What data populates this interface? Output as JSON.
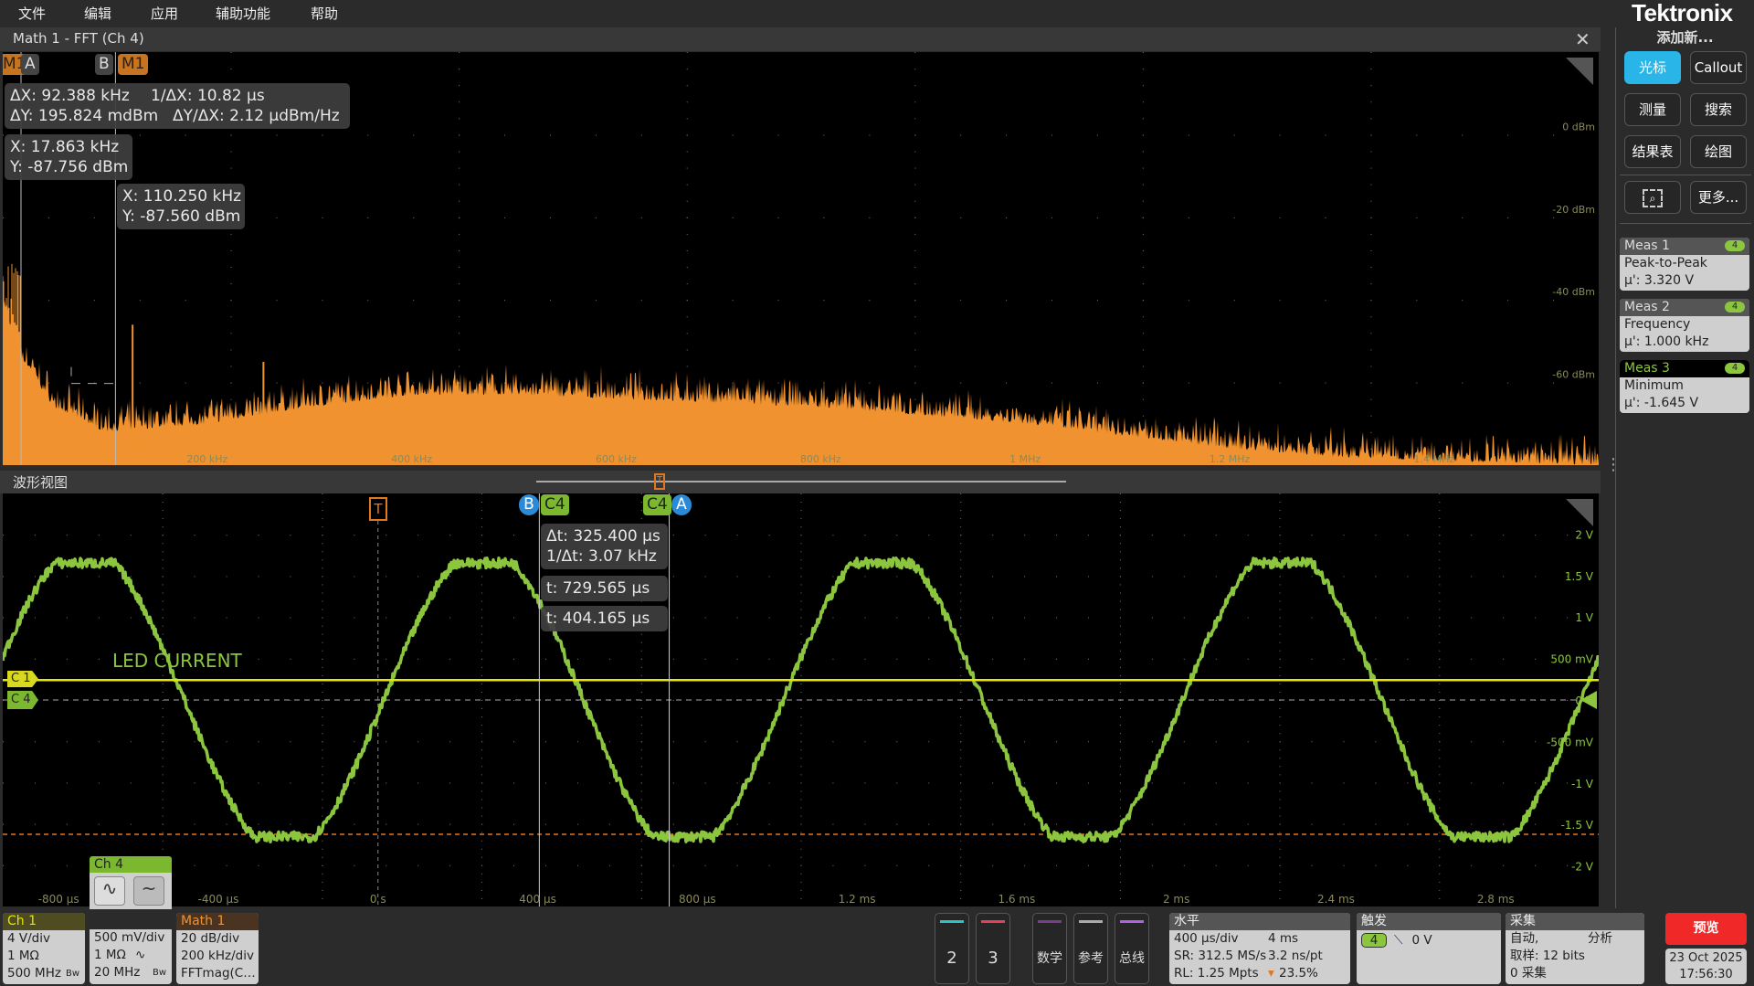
{
  "menu": [
    "文件",
    "编辑",
    "应用",
    "辅助功能",
    "帮助"
  ],
  "brand": "Tektronix",
  "fft_pane": {
    "title": "Math 1 - FFT (Ch 4)",
    "tags": {
      "m1_left": "M1",
      "a": "A",
      "b": "B",
      "m1": "M1"
    },
    "delta_readout": {
      "dx": "ΔX: 92.388 kHz",
      "inv_dx": "1/ΔX: 10.82 µs",
      "dy": "ΔY: 195.824 mdBm",
      "dydx": "ΔY/ΔX: 2.12 µdBm/Hz"
    },
    "cursor_a": {
      "x": "X: 17.863 kHz",
      "y": "Y: -87.756 dBm"
    },
    "cursor_b": {
      "x": "X: 110.250 kHz",
      "y": "Y: -87.560 dBm"
    }
  },
  "wave_pane": {
    "title": "波形视图",
    "tags": {
      "b": "B",
      "c4_b": "C4",
      "c4_a": "C4",
      "a": "A",
      "trigger": "T",
      "c1": "C 1",
      "c4": "C 4"
    },
    "label": "LED CURRENT",
    "delta_readout": {
      "dt": "Δt: 325.400 µs",
      "inv_dt": "1/Δt: 3.07 kHz"
    },
    "cursor_a_t": "t: 729.565 µs",
    "cursor_b_t": "t: 404.165 µs"
  },
  "chart_data": [
    {
      "type": "area",
      "xlabel_ticks": [
        "200 kHz",
        "400 kHz",
        "600 kHz",
        "800 kHz",
        "1 MHz",
        "1.2 MHz",
        "1.4 MHz"
      ],
      "ylabel_ticks": [
        "0 dBm",
        "-20 dBm",
        "-40 dBm",
        "-60 dBm"
      ],
      "xlim_hz": [
        0,
        1561000
      ],
      "ylim_dbm": [
        -82,
        18
      ],
      "color": "#f0922f",
      "envelope": {
        "x_hz": [
          0,
          20000,
          50000,
          100000,
          200000,
          300000,
          400000,
          500000,
          600000,
          700000,
          800000,
          900000,
          1000000,
          1100000,
          1200000,
          1300000,
          1400000,
          1561000
        ],
        "y_dbm": [
          -42,
          -55,
          -66,
          -72,
          -70,
          -66,
          -63,
          -63,
          -64,
          -65,
          -66,
          -68,
          -70,
          -73,
          -76,
          -78,
          -79,
          -80
        ]
      },
      "spurs": {
        "x_hz": [
          127000,
          255000,
          383000
        ],
        "y_dbm": [
          -48,
          -57,
          -66
        ]
      },
      "cursors_hz": {
        "A": 17863,
        "B": 110250
      }
    },
    {
      "type": "line",
      "xlabel_ticks": [
        "-800 µs",
        "-400 µs",
        "0 s",
        "400 µs",
        "800 µs",
        "1.2 ms",
        "1.6 ms",
        "2 ms",
        "2.4 ms",
        "2.8 ms"
      ],
      "ylabel_ticks": [
        "2 V",
        "1.5 V",
        "1 V",
        "500 mV",
        "0 V",
        "-500 mV",
        "-1 V",
        "-1.5 V",
        "-2 V"
      ],
      "xlim_us": [
        -940,
        3058
      ],
      "ylim_v": [
        -2.49,
        2.49
      ],
      "series": [
        {
          "name": "C4",
          "color": "#8cc63f",
          "waveform": "clipped sine",
          "frequency_hz": 1000,
          "amplitude_v": 1.85,
          "clip_v": 1.65
        },
        {
          "name": "C1",
          "color": "#e6e600",
          "level_v": 0.24
        }
      ],
      "threshold_v": -1.62,
      "cursors_us": {
        "A": 729.565,
        "B": 404.165
      },
      "trigger_us": 0
    }
  ],
  "side_panel": {
    "add_new": "添加新...",
    "buttons": [
      "光标",
      "Callout",
      "测量",
      "搜索",
      "结果表",
      "绘图",
      "更多..."
    ],
    "active_color": "#29b5e8",
    "meas": [
      {
        "title": "Meas 1",
        "badge": "4",
        "name": "Peak-to-Peak",
        "value": "µ': 3.320 V"
      },
      {
        "title": "Meas 2",
        "badge": "4",
        "name": "Frequency",
        "value": "µ': 1.000 kHz"
      },
      {
        "title": "Meas 3",
        "badge": "4",
        "name": "Minimum",
        "value": "µ': -1.645 V"
      }
    ]
  },
  "bottom": {
    "ch1": {
      "title": "Ch 1",
      "lines": [
        "4 V/div",
        "1 MΩ",
        "500 MHz"
      ],
      "bw": "Bw"
    },
    "ch4": {
      "title": "Ch 4",
      "lines": [
        "500 mV/div",
        "1 MΩ",
        "20 MHz"
      ],
      "bw": "Bw",
      "coupling": "∿"
    },
    "math1": {
      "title": "Math 1",
      "lines": [
        "20 dB/div",
        "200 kHz/div",
        "FFTmag(C…"
      ]
    },
    "buttons": [
      {
        "label": "2",
        "color": "#2bc4c4"
      },
      {
        "label": "3",
        "color": "#e8405a"
      },
      {
        "label": "数学",
        "color": "#7a3c8c"
      },
      {
        "label": "参考",
        "color": "#aaaaaa"
      },
      {
        "label": "总线",
        "color": "#b060e0"
      }
    ],
    "horizontal": {
      "title": "水平",
      "scale": "400 µs/div",
      "duration": "4 ms",
      "sr": "SR: 312.5 MS/s",
      "pt": "3.2 ns/pt",
      "rl": "RL: 1.25 Mpts",
      "pos": "23.5%"
    },
    "trigger": {
      "title": "触发",
      "source": "4",
      "level": "0 V"
    },
    "acquire": {
      "title": "采集",
      "mode": "自动,",
      "analysis": "分析",
      "sampling": "取样: 12 bits",
      "count": "0 采集"
    },
    "preview": "预览",
    "date": "23 Oct 2025",
    "time": "17:56:30"
  }
}
